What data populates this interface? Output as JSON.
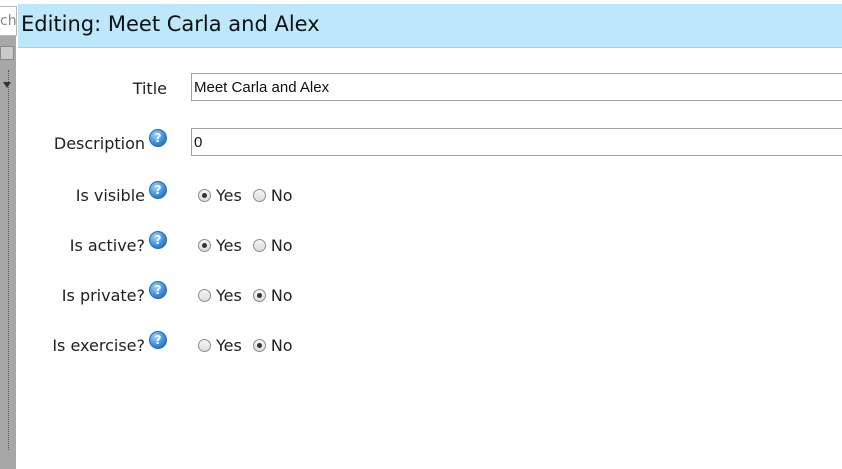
{
  "sidebar": {
    "search_stub": "ch"
  },
  "header": {
    "title": "Editing: Meet Carla and Alex"
  },
  "form": {
    "title": {
      "label": "Title",
      "value": "Meet Carla and Alex"
    },
    "description": {
      "label": "Description",
      "value": "0",
      "help": "?"
    },
    "is_visible": {
      "label": "Is visible",
      "help": "?",
      "options": [
        "Yes",
        "No"
      ],
      "selected": "Yes"
    },
    "is_active": {
      "label": "Is active?",
      "help": "?",
      "options": [
        "Yes",
        "No"
      ],
      "selected": "Yes"
    },
    "is_private": {
      "label": "Is private?",
      "help": "?",
      "options": [
        "Yes",
        "No"
      ],
      "selected": "No"
    },
    "is_exercise": {
      "label": "Is exercise?",
      "help": "?",
      "options": [
        "Yes",
        "No"
      ],
      "selected": "No"
    }
  },
  "colors": {
    "header_bg": "#bde7fb",
    "help_icon": "#3d8fd6"
  }
}
